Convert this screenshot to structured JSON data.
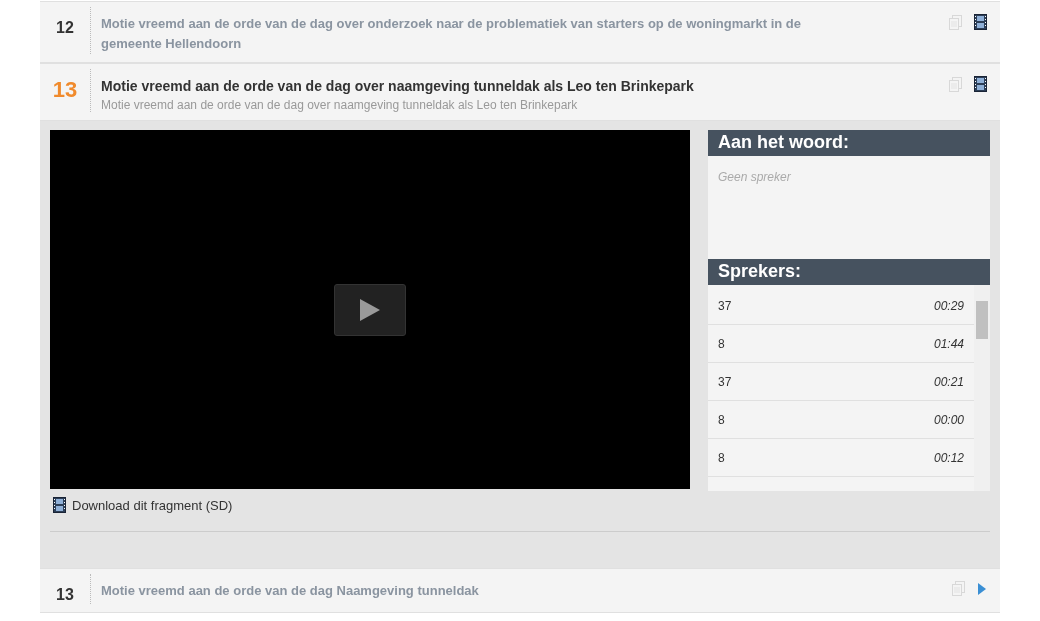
{
  "agenda_items": [
    {
      "number": "12",
      "title": "Motie vreemd aan de orde van de dag over onderzoek naar de problematiek van starters op de woningmarkt in de gemeente Hellendoorn",
      "selected": false,
      "kind": "film"
    },
    {
      "number": "13",
      "title": "Motie vreemd aan de orde van de dag over naamgeving tunneldak als Leo ten Brinkepark",
      "subtitle": "Motie vreemd aan de orde van de dag over naamgeving tunneldak als Leo ten Brinkepark",
      "selected": true,
      "kind": "film",
      "expanded": {
        "download_link": "Download dit fragment (SD)",
        "current_speaker": {
          "heading": "Aan het woord:",
          "placeholder": "Geen spreker"
        },
        "speakers": {
          "heading": "Sprekers:",
          "rows": [
            {
              "name": "37",
              "time": "00:29"
            },
            {
              "name": "8",
              "time": "01:44"
            },
            {
              "name": "37",
              "time": "00:21"
            },
            {
              "name": "8",
              "time": "00:00"
            },
            {
              "name": "8",
              "time": "00:12"
            }
          ]
        }
      }
    },
    {
      "number": "13",
      "title": "Motie vreemd aan de orde van de dag Naamgeving tunneldak",
      "selected": false,
      "kind": "play"
    }
  ]
}
